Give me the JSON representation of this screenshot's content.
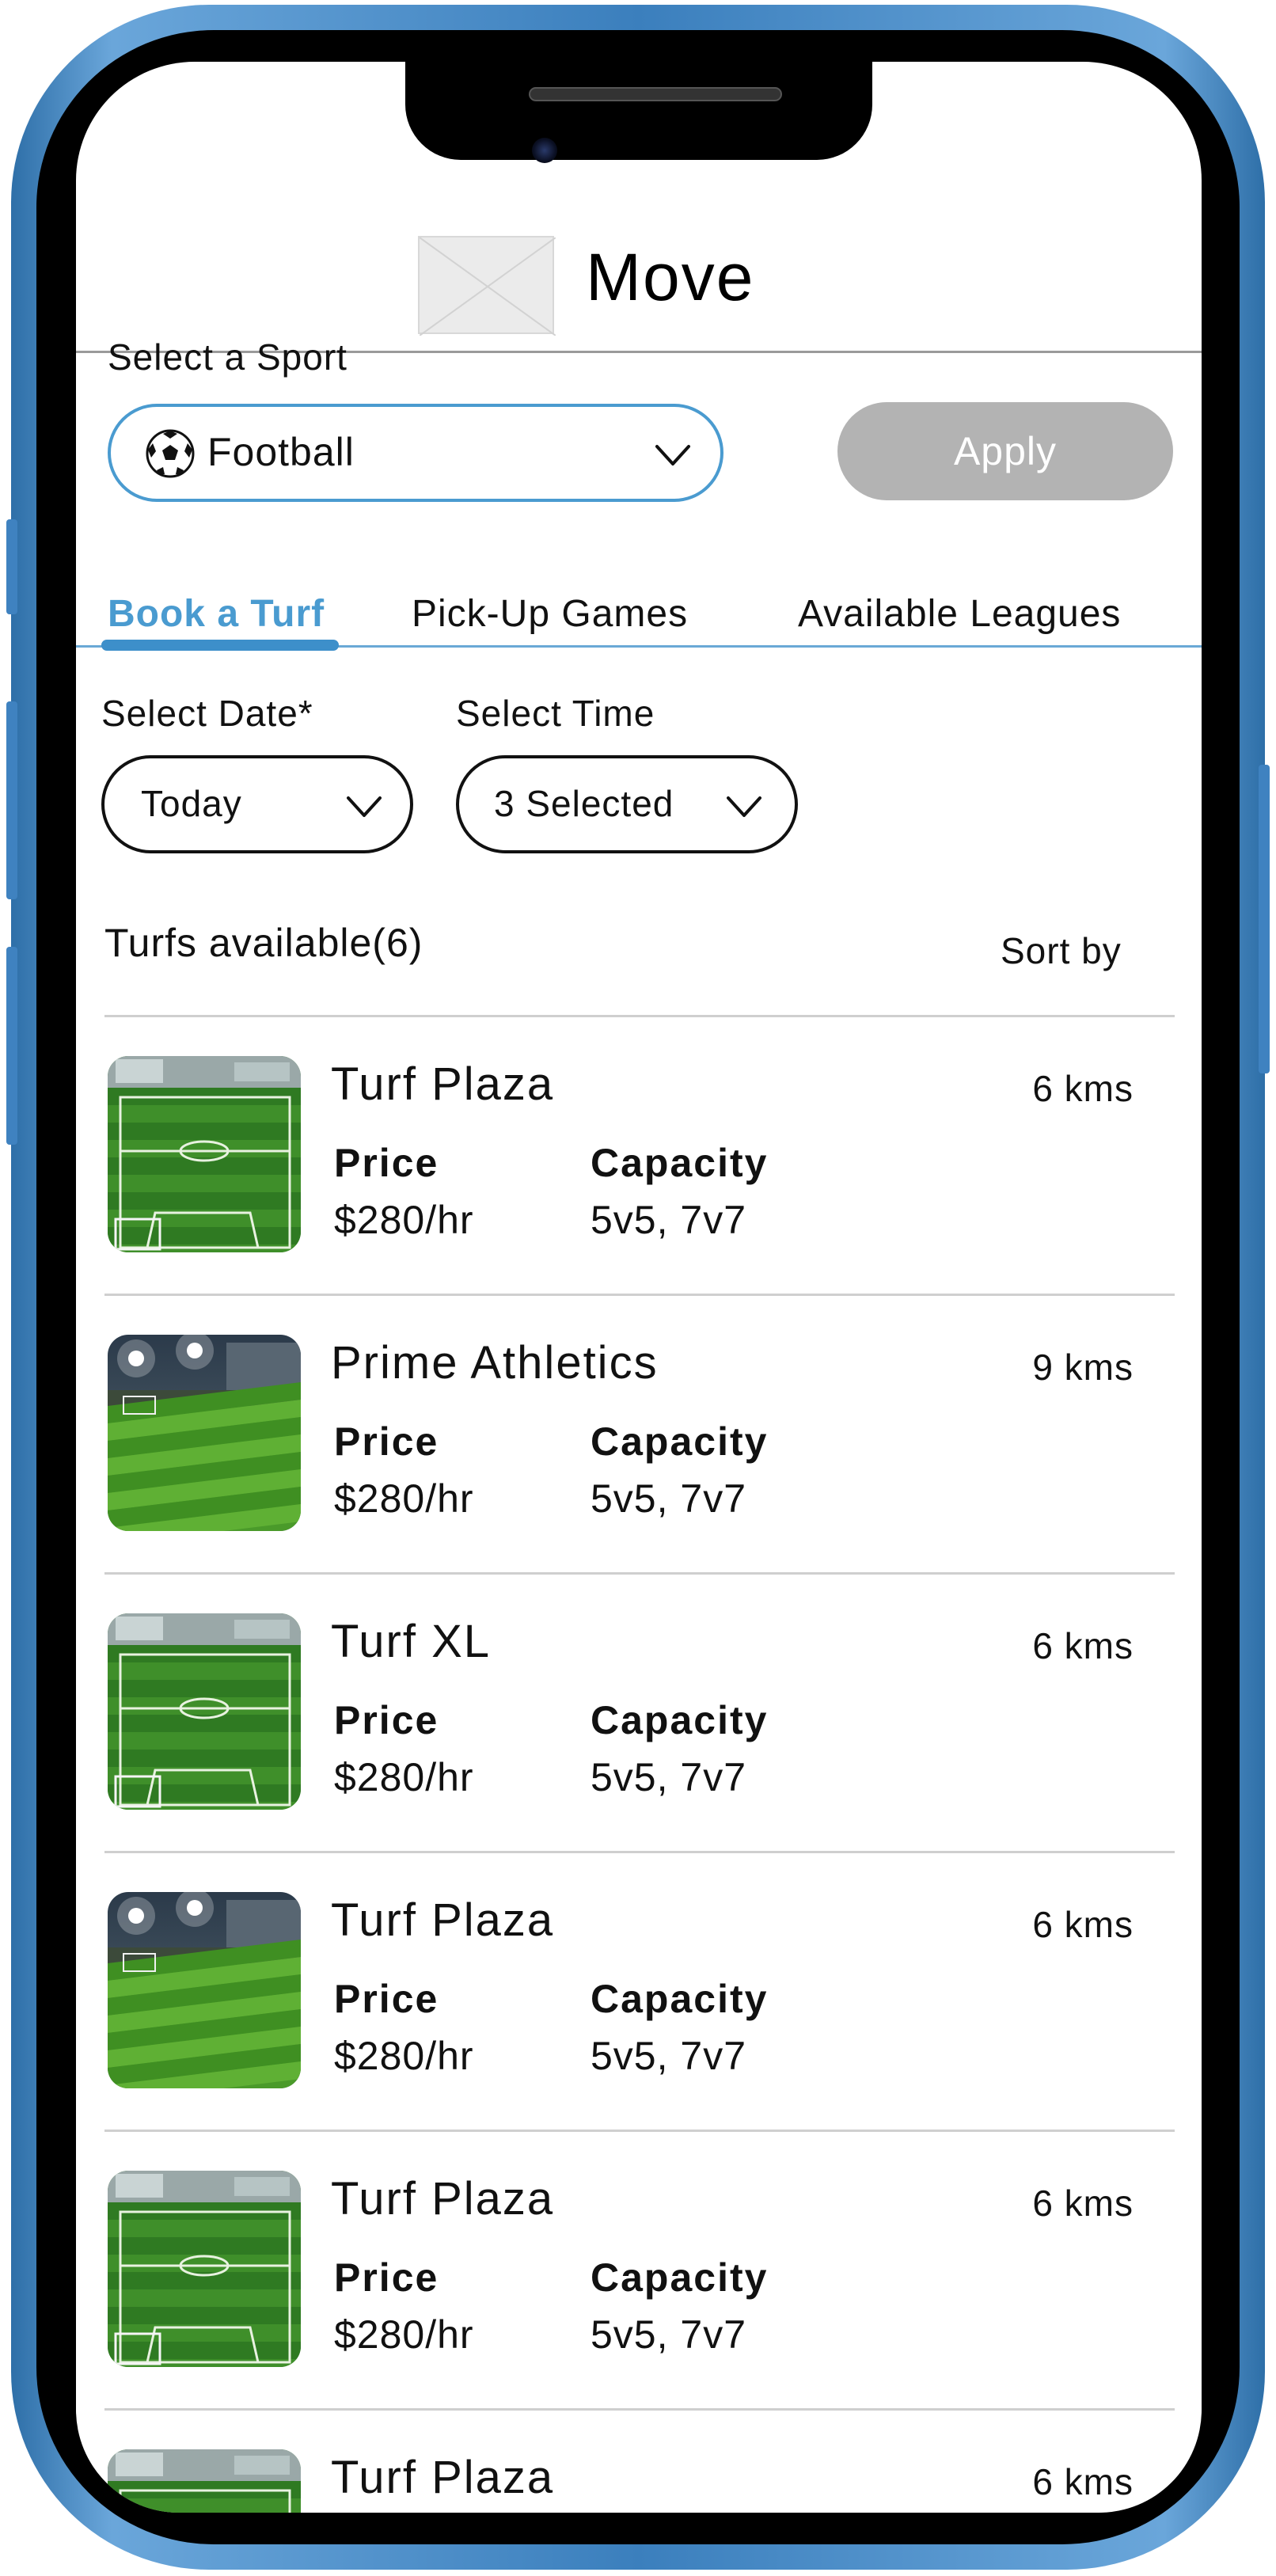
{
  "app": {
    "title": "Move"
  },
  "sport_filter": {
    "label": "Select a Sport",
    "selected": "Football",
    "selected_icon": "soccer-ball-icon",
    "apply_label": "Apply"
  },
  "tabs": [
    {
      "label": "Book a Turf",
      "active": true
    },
    {
      "label": "Pick-Up Games",
      "active": false
    },
    {
      "label": "Available Leagues",
      "active": false
    }
  ],
  "filters": {
    "date_label": "Select Date*",
    "date_value": "Today",
    "time_label": "Select Time",
    "time_value": "3 Selected"
  },
  "list": {
    "heading": "Turfs available(6)",
    "sort_label": "Sort by",
    "price_label": "Price",
    "capacity_label": "Capacity",
    "items": [
      {
        "name": "Turf Plaza",
        "distance": "6 kms",
        "price": "$280/hr",
        "capacity": "5v5, 7v7",
        "photo": "turf-aerial"
      },
      {
        "name": "Prime Athletics",
        "distance": "9 kms",
        "price": "$280/hr",
        "capacity": "5v5, 7v7",
        "photo": "turf-night"
      },
      {
        "name": "Turf XL",
        "distance": "6 kms",
        "price": "$280/hr",
        "capacity": "5v5, 7v7",
        "photo": "turf-aerial"
      },
      {
        "name": "Turf Plaza",
        "distance": "6 kms",
        "price": "$280/hr",
        "capacity": "5v5, 7v7",
        "photo": "turf-night"
      },
      {
        "name": "Turf Plaza",
        "distance": "6 kms",
        "price": "$280/hr",
        "capacity": "5v5, 7v7",
        "photo": "turf-aerial"
      },
      {
        "name": "Turf Plaza",
        "distance": "6 kms",
        "price": "",
        "capacity": "",
        "photo": "turf-aerial"
      }
    ]
  },
  "colors": {
    "accent": "#4a9bd0",
    "apply_disabled": "#b3b3b3",
    "frame": "#3b7fbd"
  }
}
